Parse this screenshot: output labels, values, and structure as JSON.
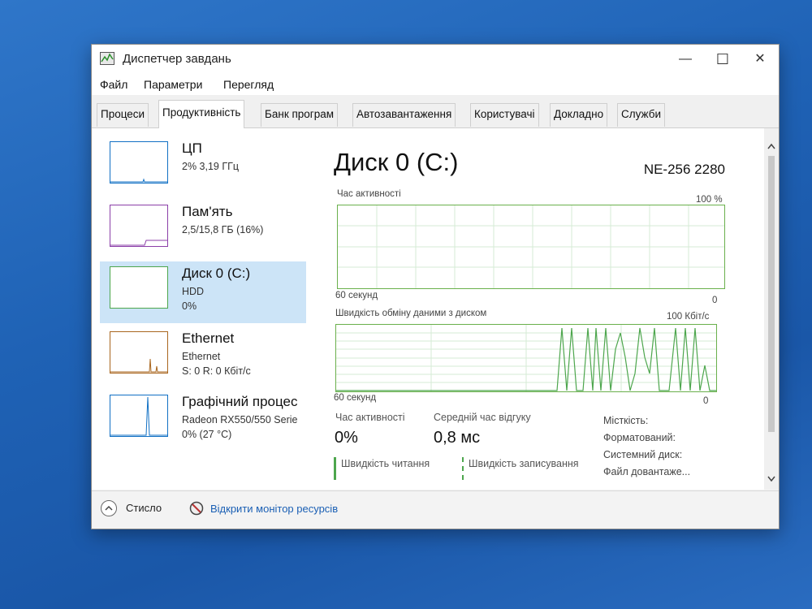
{
  "window": {
    "title": "Диспетчер завдань",
    "minimize_icon": "—",
    "maximize_icon": "☐",
    "close_icon": "✕"
  },
  "menu": [
    "Файл",
    "Параметри",
    "Перегляд"
  ],
  "tabs": [
    "Процеси",
    "Продуктивність",
    "Банк програм",
    "Автозавантаження",
    "Користувачі",
    "Докладно",
    "Служби"
  ],
  "sidebar": {
    "items": [
      {
        "title": "ЦП",
        "lines": [
          "2% 3,19 ГГц"
        ],
        "color": "#1170c4"
      },
      {
        "title": "Пам'ять",
        "lines": [
          "2,5/15,8 ГБ (16%)"
        ],
        "color": "#8b3fa8"
      },
      {
        "title": "Диск 0 (C:)",
        "lines": [
          "HDD",
          "0%"
        ],
        "color": "#4da64d"
      },
      {
        "title": "Ethernet",
        "lines": [
          "Ethernet",
          "S: 0 R: 0 Кбіт/с"
        ],
        "color": "#a9661e"
      },
      {
        "title": "Графічний процес",
        "lines": [
          "Radeon RX550/550 Serie",
          "0% (27 °C)"
        ],
        "color": "#1170c4"
      }
    ]
  },
  "main": {
    "title": "Диск 0 (C:)",
    "model": "NE-256 2280",
    "graph1": {
      "label": "Час активності",
      "max_label": "100 %",
      "time_label": "60 секунд",
      "min_label": "0"
    },
    "graph2": {
      "label": "Швидкість обміну даними з диском",
      "max_label": "100 Кбіт/с",
      "time_label": "60 секунд",
      "min_label": "0"
    },
    "stats": {
      "active_time_label": "Час активності",
      "active_time_value": "0%",
      "response_label": "Середній час відгуку",
      "response_value": "0,8 мс",
      "read_label": "Швидкість читання",
      "write_label": "Швидкість записування"
    },
    "properties": [
      "Місткість:",
      "Форматований:",
      "Системний диск:",
      "Файл довантаже..."
    ]
  },
  "footer": {
    "less_label": "Стисло",
    "monitor_label": "Відкрити монітор ресурсів"
  },
  "colors": {
    "disk_green": "#4da64d",
    "selected_bg": "#cce4f7",
    "link": "#1a5fb4"
  }
}
